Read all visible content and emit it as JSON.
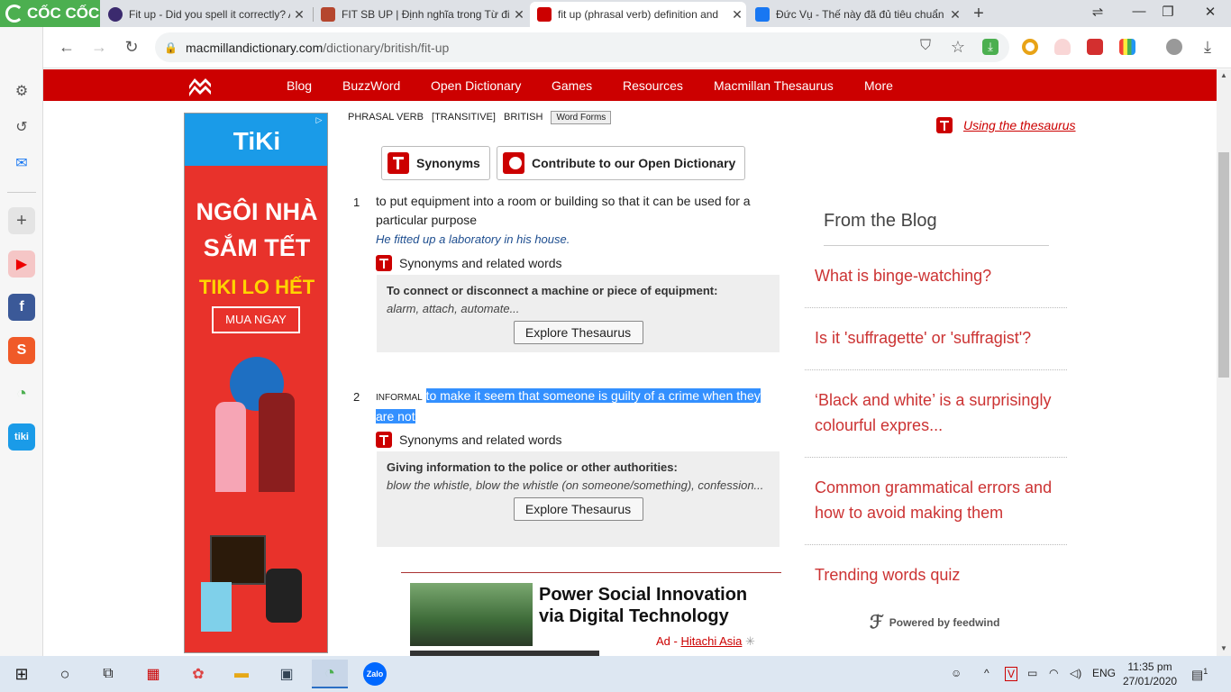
{
  "browser": {
    "brand": "CỐC CỐC",
    "tabs": [
      {
        "title": "Fit up - Did you spell it correctly? A",
        "favicon_color": "#3b2a6e",
        "active": false
      },
      {
        "title": "FIT SB UP | Định nghĩa trong Từ điể",
        "favicon_color": "#b5462e",
        "active": false
      },
      {
        "title": "fit up (phrasal verb) definition and",
        "favicon_color": "#c00000",
        "active": true
      },
      {
        "title": "Đức Vụ - Thế này đã đủ tiêu chuẩn",
        "favicon_color": "#1877f2",
        "active": false
      }
    ],
    "url_host": "macmillandictionary.com",
    "url_path": "/dictionary/british/fit-up",
    "icons": {
      "back": "←",
      "forward": "→",
      "reload": "↻",
      "lock": "🔒",
      "star": "☆",
      "download": "⤓",
      "new_tab": "+",
      "minimize": "—",
      "maximize": "❐",
      "close": "✕"
    }
  },
  "sidebar": {
    "icons": [
      "settings-icon",
      "history-icon",
      "messenger-icon",
      "add-icon",
      "youtube-icon",
      "facebook-icon",
      "shopee-icon",
      "coccoc-icon",
      "tiki-icon"
    ]
  },
  "site_nav": {
    "items": [
      "Blog",
      "BuzzWord",
      "Open Dictionary",
      "Games",
      "Resources",
      "Macmillan Thesaurus",
      "More"
    ]
  },
  "left_ad": {
    "brand": "TiKi",
    "line1": "NGÔI NHÀ",
    "line2": "SẮM TẾT",
    "line3": "TIKI LO HẾT",
    "button": "MUA NGAY"
  },
  "entry": {
    "labels": [
      "PHRASAL VERB",
      "[TRANSITIVE]",
      "BRITISH"
    ],
    "word_forms": "Word Forms",
    "synonyms_button": "Synonyms",
    "contribute_button": "Contribute to our Open Dictionary",
    "senses": [
      {
        "number": "1",
        "definition": "to put equipment into a room or building so that it can be used for a particular purpose",
        "example": "He fitted up a laboratory in his house.",
        "related_label": "Synonyms and related words",
        "thesaurus_heading": "To connect or disconnect a machine or piece of equipment:",
        "thesaurus_words": "alarm, attach, automate...",
        "explore": "Explore Thesaurus"
      },
      {
        "number": "2",
        "register": "INFORMAL",
        "definition": "to make it seem that someone is guilty of a crime when they are not",
        "related_label": "Synonyms and related words",
        "thesaurus_heading": "Giving information to the police or other authorities:",
        "thesaurus_words": "blow the whistle, blow the whistle (on someone/something), confession...",
        "explore": "Explore Thesaurus"
      }
    ]
  },
  "bottom_ad": {
    "title": "Power Social Innovation via Digital Technology",
    "ad_label": "Ad -",
    "advertiser": "Hitachi Asia"
  },
  "right": {
    "thesaurus_link": "Using the thesaurus",
    "blog_heading": "From the Blog",
    "blog_items": [
      "What is binge-watching?",
      "Is it 'suffragette' or 'suffragist'?",
      "‘Black and white’ is a surprisingly colourful expres...",
      "Common grammatical errors and how to avoid making them",
      "Trending words quiz"
    ],
    "powered_by": "Powered by feedwind"
  },
  "taskbar": {
    "language": "ENG",
    "time": "11:35 pm",
    "date": "27/01/2020",
    "notifications": "1",
    "zalo": "Zalo"
  },
  "colors": {
    "brand_red": "#cc0000",
    "highlight": "#3390ff",
    "blog_red": "#cc3333"
  }
}
